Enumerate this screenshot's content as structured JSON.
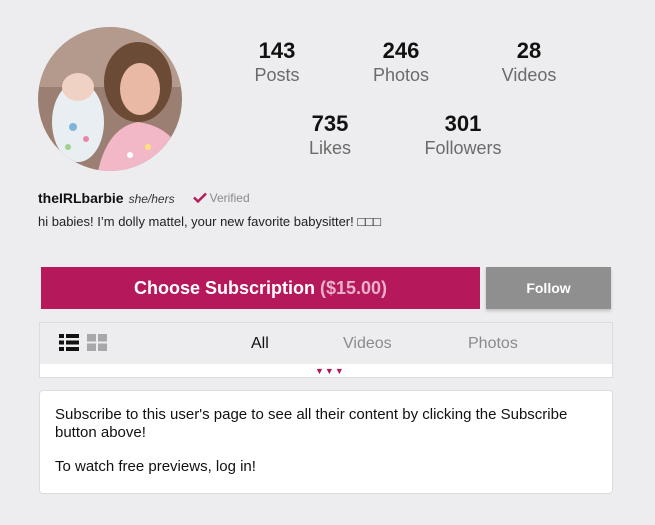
{
  "profile": {
    "username": "theIRLbarbie",
    "pronouns": "she/hers",
    "verified_label": "Verified",
    "bio": "hi babies! I’m dolly mattel, your new favorite babysitter! □□□"
  },
  "stats": {
    "posts": {
      "value": "143",
      "label": "Posts"
    },
    "photos": {
      "value": "246",
      "label": "Photos"
    },
    "videos": {
      "value": "28",
      "label": "Videos"
    },
    "likes": {
      "value": "735",
      "label": "Likes"
    },
    "followers": {
      "value": "301",
      "label": "Followers"
    }
  },
  "actions": {
    "subscribe_label": "Choose Subscription",
    "subscribe_price": "($15.00)",
    "follow_label": "Follow"
  },
  "tabs": {
    "all": "All",
    "videos": "Videos",
    "photos": "Photos"
  },
  "expand_indicator": "▼▼▼",
  "notice": {
    "line1": "Subscribe to this user's page to see all their content by clicking the Subscribe button above!",
    "line2": "To watch free previews, log in!"
  },
  "colors": {
    "accent": "#b5195b",
    "follow_button": "#8f8f8f",
    "background": "#ededf0"
  },
  "icons": [
    "check-icon",
    "list-view-icon",
    "grid-view-icon",
    "chevron-down-icon"
  ]
}
